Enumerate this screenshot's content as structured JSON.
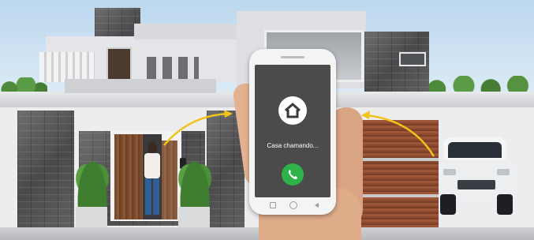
{
  "phone": {
    "status_text": "Casa chamando...",
    "home_icon": "home-icon",
    "answer_icon": "phone-answer-icon"
  },
  "colors": {
    "sky": "#cfe3f3",
    "wall": "#e6e7e9",
    "stone": "#5a5a5c",
    "wood": "#8b4a2f",
    "answer_button": "#2db34a",
    "arrow": "#f0c419"
  }
}
